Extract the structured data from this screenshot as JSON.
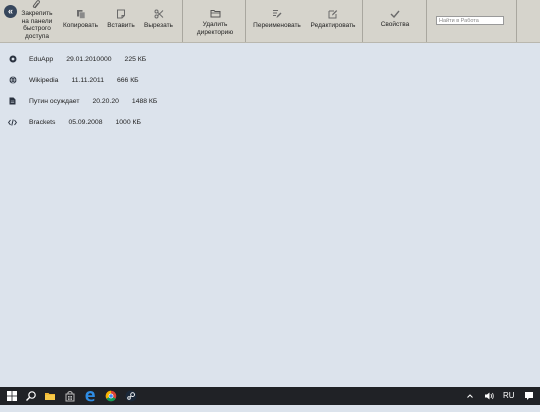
{
  "toolbar": {
    "pin_label": "Закрепить на панели быстрого доступа",
    "copy_label": "Копировать",
    "paste_label": "Вставить",
    "cut_label": "Вырезать",
    "delete_dir_label": "Удалить директорию",
    "rename_label": "Переименовать",
    "edit_label": "Редактировать",
    "properties_label": "Свойства",
    "search_placeholder": "Найти в Работа"
  },
  "files": [
    {
      "icon": "app-circle-icon",
      "name": "EduApp",
      "date": "29.01.2010000",
      "size": "225 КБ"
    },
    {
      "icon": "globe-icon",
      "name": "Wikipedia",
      "date": "11.11.2011",
      "size": "666 КБ"
    },
    {
      "icon": "document-icon",
      "name": "Путин осуждает",
      "date": "20.20.20",
      "size": "1488 КБ"
    },
    {
      "icon": "code-icon",
      "name": "Brackets",
      "date": "05.09.2008",
      "size": "1000 КБ"
    }
  ],
  "taskbar": {
    "language": "RU"
  },
  "colors": {
    "background": "#dce3ec",
    "toolbar": "#d6d4cc",
    "taskbar": "#202226",
    "accent": "#36465c"
  }
}
